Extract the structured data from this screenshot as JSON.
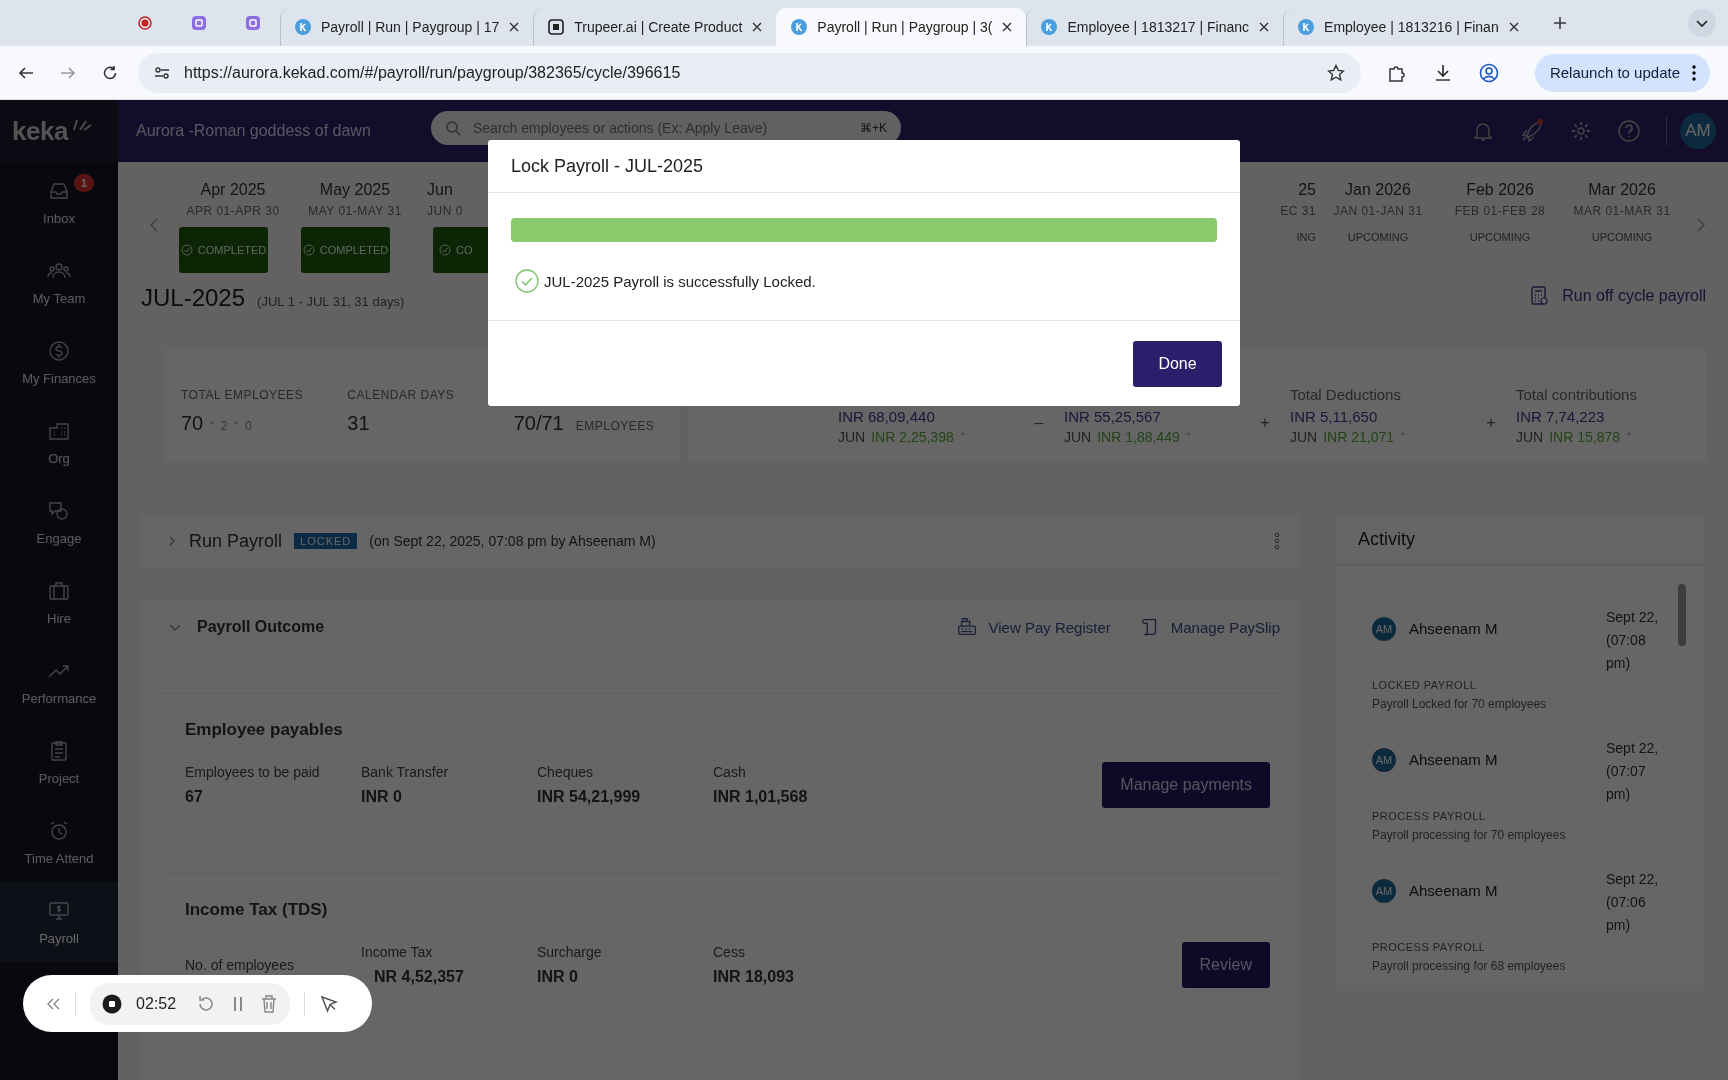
{
  "browser": {
    "pinned_tabs": [
      {
        "kind": "record"
      },
      {
        "kind": "app"
      },
      {
        "kind": "app"
      }
    ],
    "tabs": [
      {
        "title": "Payroll | Run | Paygroup | 17",
        "kind": "keka",
        "selected": false
      },
      {
        "title": "Trupeer.ai | Create Product",
        "kind": "trupeer",
        "selected": false
      },
      {
        "title": "Payroll | Run | Paygroup | 3(",
        "kind": "keka",
        "selected": true
      },
      {
        "title": "Employee | 1813217 | Financ",
        "kind": "keka",
        "selected": false
      },
      {
        "title": "Employee | 1813216 | Finan",
        "kind": "keka",
        "selected": false
      }
    ],
    "url": "https://aurora.kekad.com/#/payroll/run/paygroup/382365/cycle/396615",
    "relaunch": "Relaunch to update"
  },
  "header": {
    "logo": "keka",
    "org": "Aurora -Roman goddess of dawn",
    "search_placeholder": "Search employees or actions (Ex: Apply Leave)",
    "shortcut": "⌘+K",
    "avatar": "AM"
  },
  "sidebar": {
    "items": [
      {
        "label": "Inbox",
        "badge": "1",
        "selected": false
      },
      {
        "label": "My Team",
        "selected": false
      },
      {
        "label": "My Finances",
        "selected": false
      },
      {
        "label": "Org",
        "selected": false
      },
      {
        "label": "Engage",
        "selected": false
      },
      {
        "label": "Hire",
        "selected": false
      },
      {
        "label": "Performance",
        "selected": false
      },
      {
        "label": "Project",
        "selected": false
      },
      {
        "label": "Time Attend",
        "selected": false
      },
      {
        "label": "Payroll",
        "selected": true
      }
    ]
  },
  "months": [
    {
      "name": "Apr 2025",
      "range": "APR 01-APR 30",
      "status": "COMPLETED",
      "kind": "completed"
    },
    {
      "name": "May 2025",
      "range": "MAY 01-MAY 31",
      "status": "COMPLETED",
      "kind": "completed"
    },
    {
      "name": "Jun",
      "range": "JUN 0",
      "status": "CO",
      "kind": "completed"
    },
    {
      "name": "25",
      "range": "EC 31",
      "status": "ING",
      "kind": "upcoming"
    },
    {
      "name": "Jan 2026",
      "range": "JAN 01-JAN 31",
      "status": "UPCOMING",
      "kind": "upcoming"
    },
    {
      "name": "Feb 2026",
      "range": "FEB 01-FEB 28",
      "status": "UPCOMING",
      "kind": "upcoming"
    },
    {
      "name": "Mar 2026",
      "range": "MAR 01-MAR 31",
      "status": "UPCOMING",
      "kind": "upcoming"
    }
  ],
  "cycle": {
    "title": "JUL-2025",
    "range": "(JUL 1 - JUL 31, 31 days)",
    "off_cycle": "Run off cycle payroll"
  },
  "summary": {
    "stats": [
      {
        "label": "TOTAL EMPLOYEES",
        "value": "70",
        "changes": [
          {
            "arrow": "˄",
            "value": "2"
          },
          {
            "arrow": "˅",
            "value": "0"
          }
        ]
      },
      {
        "label": "CALENDAR DAYS",
        "value": "31"
      },
      {
        "value": "70/71",
        "unit": "EMPLOYEES"
      }
    ],
    "totals": [
      {
        "value": "INR 68,09,440",
        "period": "JUN",
        "change": "INR 2,25,398",
        "arrow": "˄"
      },
      {
        "operator": "–",
        "value": "INR 55,25,567",
        "period": "JUN",
        "change": "INR 1,88,449",
        "arrow": "˄"
      },
      {
        "operator": "+",
        "label": "Total Deductions",
        "value": "INR 5,11,650",
        "period": "JUN",
        "change": "INR 21,071",
        "arrow": "˄"
      },
      {
        "operator": "+",
        "label": "Total contributions",
        "value": "INR 7,74,223",
        "period": "JUN",
        "change": "INR 15,878",
        "arrow": "˄"
      }
    ]
  },
  "run_payroll": {
    "title": "Run Payroll",
    "badge": "LOCKED",
    "meta": "(on Sept 22, 2025, 07:08 pm by Ahseenam M)",
    "expanded": false
  },
  "payroll_outcome": {
    "title": "Payroll Outcome",
    "expanded": true,
    "links": [
      {
        "label": "View Pay Register",
        "kind": "register"
      },
      {
        "label": "Manage PaySlip",
        "kind": "payslip"
      }
    ],
    "cards": [
      {
        "title": "Employee payables",
        "fields": [
          {
            "label": "Employees to be paid",
            "value": "67"
          },
          {
            "label": "Bank Transfer",
            "value": "INR 0"
          },
          {
            "label": "Cheques",
            "value": "INR 54,21,999"
          },
          {
            "label": "Cash",
            "value": "INR 1,01,568"
          }
        ],
        "button": "Manage payments"
      },
      {
        "title": "Income Tax (TDS)",
        "fields": [
          {
            "label": "No. of employees"
          },
          {
            "label": "Income Tax",
            "value": "NR 4,52,357"
          },
          {
            "label": "Surcharge",
            "value": "INR 0"
          },
          {
            "label": "Cess",
            "value": "INR 18,093"
          }
        ],
        "button": "Review"
      }
    ]
  },
  "activity": {
    "title": "Activity",
    "entries": [
      {
        "initials": "AM",
        "name": "Ahseenam M",
        "time": "Sept 22, (07:08 pm)",
        "action": "LOCKED PAYROLL",
        "detail": "Payroll Locked for 70 employees"
      },
      {
        "initials": "AM",
        "name": "Ahseenam M",
        "time": "Sept 22, (07:07 pm)",
        "action": "PROCESS PAYROLL",
        "detail": "Payroll processing for 70 employees"
      },
      {
        "initials": "AM",
        "name": "Ahseenam M",
        "time": "Sept 22, (07:06 pm)",
        "action": "PROCESS PAYROLL",
        "detail": "Payroll processing for 68 employees"
      }
    ]
  },
  "modal": {
    "title": "Lock Payroll - JUL-2025",
    "level": 1,
    "message": "JUL-2025 Payroll is successfully Locked.",
    "button": "Done"
  },
  "recorder": {
    "time": "02:52"
  }
}
